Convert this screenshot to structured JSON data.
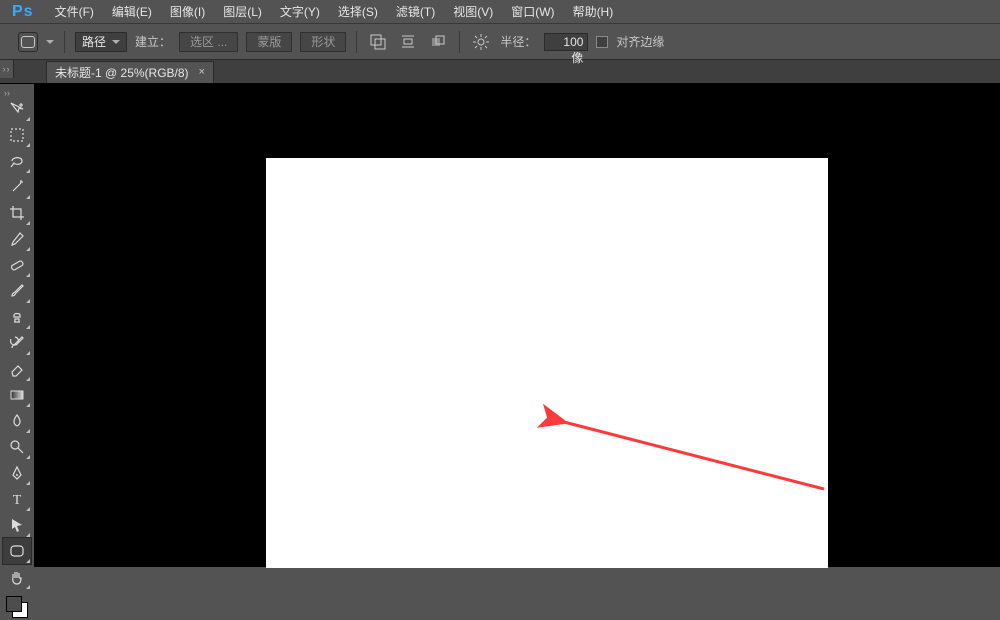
{
  "menubar": {
    "items": [
      "文件(F)",
      "编辑(E)",
      "图像(I)",
      "图层(L)",
      "文字(Y)",
      "选择(S)",
      "滤镜(T)",
      "视图(V)",
      "窗口(W)",
      "帮助(H)"
    ]
  },
  "optionsbar": {
    "tool_icon": "rounded-rectangle",
    "mode_select": "路径",
    "build_label": "建立：",
    "btn_selection": "选区 ...",
    "btn_mask": "蒙版",
    "btn_shape": "形状",
    "align_icon": "path-align",
    "arrange_icon": "path-arrange",
    "pathops_icon": "path-ops",
    "gear_icon": "gear",
    "radius_label": "半径：",
    "radius_value": "100 像",
    "align_edges_label": "对齐边缘"
  },
  "doc_tab": {
    "title": "未标题-1 @ 25%(RGB/8)",
    "close": "×"
  },
  "tools": [
    {
      "name": "move-tool",
      "icon": "move"
    },
    {
      "name": "marquee-tool",
      "icon": "marquee"
    },
    {
      "name": "lasso-tool",
      "icon": "lasso"
    },
    {
      "name": "magic-wand-tool",
      "icon": "wand"
    },
    {
      "name": "crop-tool",
      "icon": "crop"
    },
    {
      "name": "eyedropper-tool",
      "icon": "eyedrop"
    },
    {
      "name": "healing-brush-tool",
      "icon": "bandaid"
    },
    {
      "name": "brush-tool",
      "icon": "brush"
    },
    {
      "name": "stamp-tool",
      "icon": "stamp"
    },
    {
      "name": "history-brush-tool",
      "icon": "hist"
    },
    {
      "name": "eraser-tool",
      "icon": "eraser"
    },
    {
      "name": "gradient-tool",
      "icon": "gradient"
    },
    {
      "name": "blur-tool",
      "icon": "blur"
    },
    {
      "name": "dodge-tool",
      "icon": "dodge"
    },
    {
      "name": "pen-tool",
      "icon": "pen"
    },
    {
      "name": "type-tool",
      "icon": "type"
    },
    {
      "name": "path-select-tool",
      "icon": "arrow"
    },
    {
      "name": "shape-tool",
      "icon": "rounded-rect",
      "selected": true
    },
    {
      "name": "hand-tool",
      "icon": "hand"
    }
  ]
}
